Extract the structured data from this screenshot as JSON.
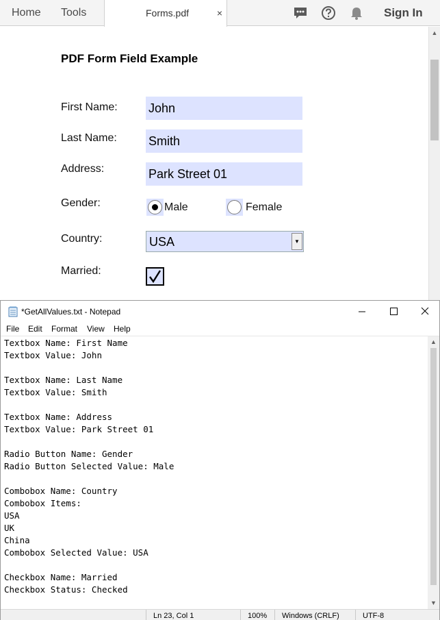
{
  "pdf_viewer": {
    "nav": {
      "home": "Home",
      "tools": "Tools"
    },
    "file_tab": {
      "label": "Forms.pdf",
      "close": "×"
    },
    "sign_in": "Sign In",
    "icons": [
      "comment-icon",
      "help-icon",
      "bell-icon"
    ],
    "form": {
      "title": "PDF Form Field Example",
      "first_name": {
        "label": "First Name:",
        "value": "John"
      },
      "last_name": {
        "label": "Last Name:",
        "value": "Smith"
      },
      "address": {
        "label": "Address:",
        "value": "Park Street 01"
      },
      "gender": {
        "label": "Gender:",
        "options": [
          "Male",
          "Female"
        ],
        "selected": "Male"
      },
      "country": {
        "label": "Country:",
        "value": "USA"
      },
      "married": {
        "label": "Married:",
        "checked": true
      }
    },
    "field_color": "#dde3ff"
  },
  "notepad": {
    "title": "*GetAllValues.txt - Notepad",
    "menu": [
      "File",
      "Edit",
      "Format",
      "View",
      "Help"
    ],
    "lines": [
      "Textbox Name: First Name",
      "Textbox Value: John",
      "",
      "Textbox Name: Last Name",
      "Textbox Value: Smith",
      "",
      "Textbox Name: Address",
      "Textbox Value: Park Street 01",
      "",
      "Radio Button Name: Gender",
      "Radio Button Selected Value: Male",
      "",
      "Combobox Name: Country",
      "Combobox Items:",
      "USA",
      "UK",
      "China",
      "Combobox Selected Value: USA",
      "",
      "Checkbox Name: Married",
      "Checkbox Status: Checked"
    ],
    "status": {
      "position": "Ln 23, Col 1",
      "zoom": "100%",
      "line_ending": "Windows (CRLF)",
      "encoding": "UTF-8"
    }
  }
}
